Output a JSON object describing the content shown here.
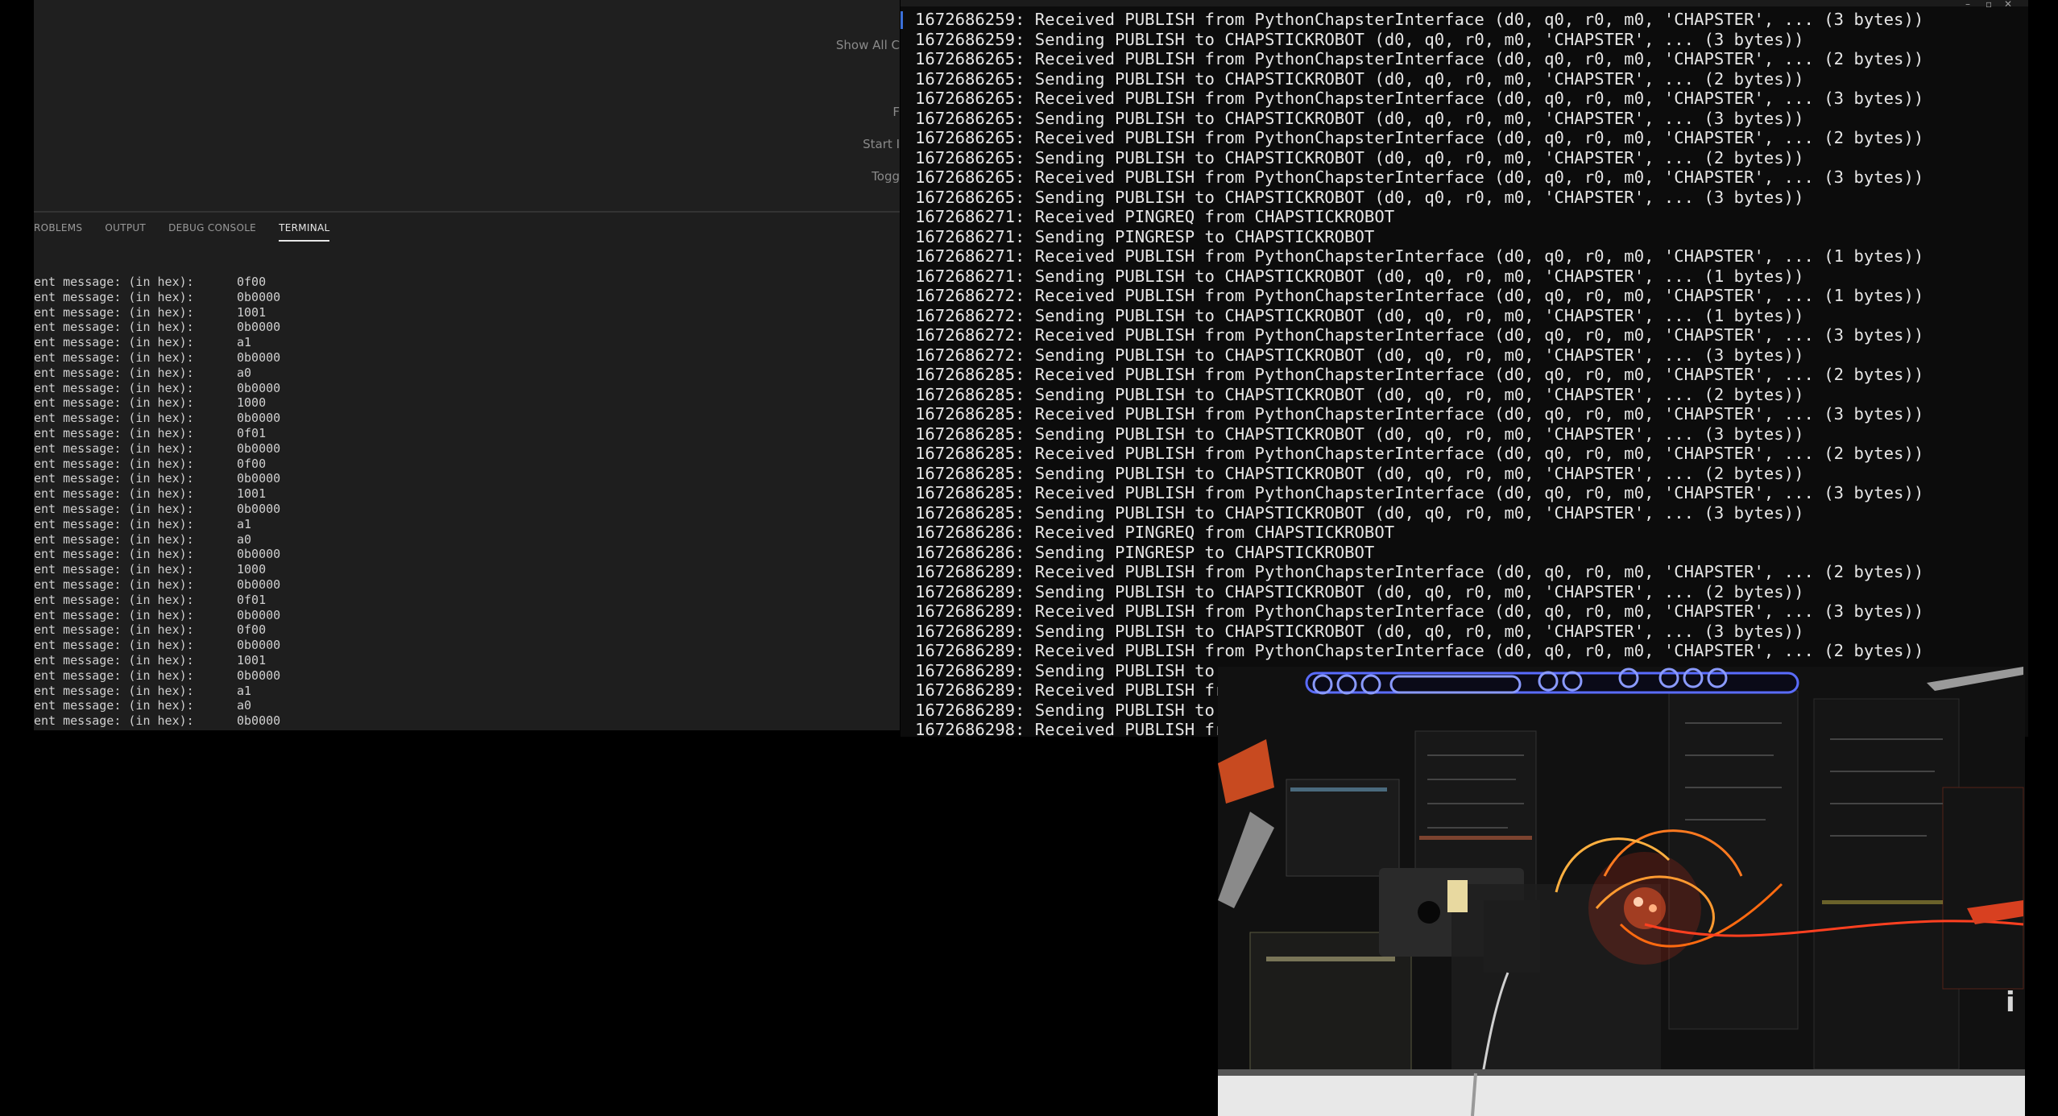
{
  "vscode": {
    "welcome_hints": [
      "Show All C",
      "F",
      "Start I",
      "Togg"
    ],
    "panel_tabs": [
      {
        "label": "ROBLEMS",
        "active": false
      },
      {
        "label": "OUTPUT",
        "active": false
      },
      {
        "label": "DEBUG CONSOLE",
        "active": false
      },
      {
        "label": "TERMINAL",
        "active": true
      }
    ],
    "terminal_prefix": "ent message: (in hex):",
    "terminal_values": [
      "0f00",
      "0b0000",
      "1001",
      "0b0000",
      "a1",
      "0b0000",
      "a0",
      "0b0000",
      "1000",
      "0b0000",
      "0f01",
      "0b0000",
      "0f00",
      "0b0000",
      "1001",
      "0b0000",
      "a1",
      "a0",
      "0b0000",
      "1000",
      "0b0000",
      "0f01",
      "0b0000",
      "0f00",
      "0b0000",
      "1001",
      "0b0000",
      "a1",
      "a0",
      "0b0000"
    ]
  },
  "mqtt_log": {
    "lines": [
      "1672686259: Received PUBLISH from PythonChapsterInterface (d0, q0, r0, m0, 'CHAPSTER', ... (3 bytes))",
      "1672686259: Sending PUBLISH to CHAPSTICKROBOT (d0, q0, r0, m0, 'CHAPSTER', ... (3 bytes))",
      "1672686265: Received PUBLISH from PythonChapsterInterface (d0, q0, r0, m0, 'CHAPSTER', ... (2 bytes))",
      "1672686265: Sending PUBLISH to CHAPSTICKROBOT (d0, q0, r0, m0, 'CHAPSTER', ... (2 bytes))",
      "1672686265: Received PUBLISH from PythonChapsterInterface (d0, q0, r0, m0, 'CHAPSTER', ... (3 bytes))",
      "1672686265: Sending PUBLISH to CHAPSTICKROBOT (d0, q0, r0, m0, 'CHAPSTER', ... (3 bytes))",
      "1672686265: Received PUBLISH from PythonChapsterInterface (d0, q0, r0, m0, 'CHAPSTER', ... (2 bytes))",
      "1672686265: Sending PUBLISH to CHAPSTICKROBOT (d0, q0, r0, m0, 'CHAPSTER', ... (2 bytes))",
      "1672686265: Received PUBLISH from PythonChapsterInterface (d0, q0, r0, m0, 'CHAPSTER', ... (3 bytes))",
      "1672686265: Sending PUBLISH to CHAPSTICKROBOT (d0, q0, r0, m0, 'CHAPSTER', ... (3 bytes))",
      "1672686271: Received PINGREQ from CHAPSTICKROBOT",
      "1672686271: Sending PINGRESP to CHAPSTICKROBOT",
      "1672686271: Received PUBLISH from PythonChapsterInterface (d0, q0, r0, m0, 'CHAPSTER', ... (1 bytes))",
      "1672686271: Sending PUBLISH to CHAPSTICKROBOT (d0, q0, r0, m0, 'CHAPSTER', ... (1 bytes))",
      "1672686272: Received PUBLISH from PythonChapsterInterface (d0, q0, r0, m0, 'CHAPSTER', ... (1 bytes))",
      "1672686272: Sending PUBLISH to CHAPSTICKROBOT (d0, q0, r0, m0, 'CHAPSTER', ... (1 bytes))",
      "1672686272: Received PUBLISH from PythonChapsterInterface (d0, q0, r0, m0, 'CHAPSTER', ... (3 bytes))",
      "1672686272: Sending PUBLISH to CHAPSTICKROBOT (d0, q0, r0, m0, 'CHAPSTER', ... (3 bytes))",
      "1672686285: Received PUBLISH from PythonChapsterInterface (d0, q0, r0, m0, 'CHAPSTER', ... (2 bytes))",
      "1672686285: Sending PUBLISH to CHAPSTICKROBOT (d0, q0, r0, m0, 'CHAPSTER', ... (2 bytes))",
      "1672686285: Received PUBLISH from PythonChapsterInterface (d0, q0, r0, m0, 'CHAPSTER', ... (3 bytes))",
      "1672686285: Sending PUBLISH to CHAPSTICKROBOT (d0, q0, r0, m0, 'CHAPSTER', ... (3 bytes))",
      "1672686285: Received PUBLISH from PythonChapsterInterface (d0, q0, r0, m0, 'CHAPSTER', ... (2 bytes))",
      "1672686285: Sending PUBLISH to CHAPSTICKROBOT (d0, q0, r0, m0, 'CHAPSTER', ... (2 bytes))",
      "1672686285: Received PUBLISH from PythonChapsterInterface (d0, q0, r0, m0, 'CHAPSTER', ... (3 bytes))",
      "1672686285: Sending PUBLISH to CHAPSTICKROBOT (d0, q0, r0, m0, 'CHAPSTER', ... (3 bytes))",
      "1672686286: Received PINGREQ from CHAPSTICKROBOT",
      "1672686286: Sending PINGRESP to CHAPSTICKROBOT",
      "1672686289: Received PUBLISH from PythonChapsterInterface (d0, q0, r0, m0, 'CHAPSTER', ... (2 bytes))",
      "1672686289: Sending PUBLISH to CHAPSTICKROBOT (d0, q0, r0, m0, 'CHAPSTER', ... (2 bytes))",
      "1672686289: Received PUBLISH from PythonChapsterInterface (d0, q0, r0, m0, 'CHAPSTER', ... (3 bytes))",
      "1672686289: Sending PUBLISH to CHAPSTICKROBOT (d0, q0, r0, m0, 'CHAPSTER', ... (3 bytes))",
      "1672686289: Received PUBLISH from PythonChapsterInterface (d0, q0, r0, m0, 'CHAPSTER', ... (2 bytes))",
      "1672686289: Sending PUBLISH to",
      "1672686289: Received PUBLISH fr",
      "1672686289: Sending PUBLISH to",
      "1672686298: Received PUBLISH fr"
    ]
  },
  "webcam": {
    "edge_text": "i"
  },
  "colors": {
    "vscode_bg": "#1e1e1e",
    "console_bg": "#0c0c0c",
    "console_text": "#e6e6e6",
    "led_glow": "#ff3a1a",
    "underglow": "#5a6cff"
  }
}
